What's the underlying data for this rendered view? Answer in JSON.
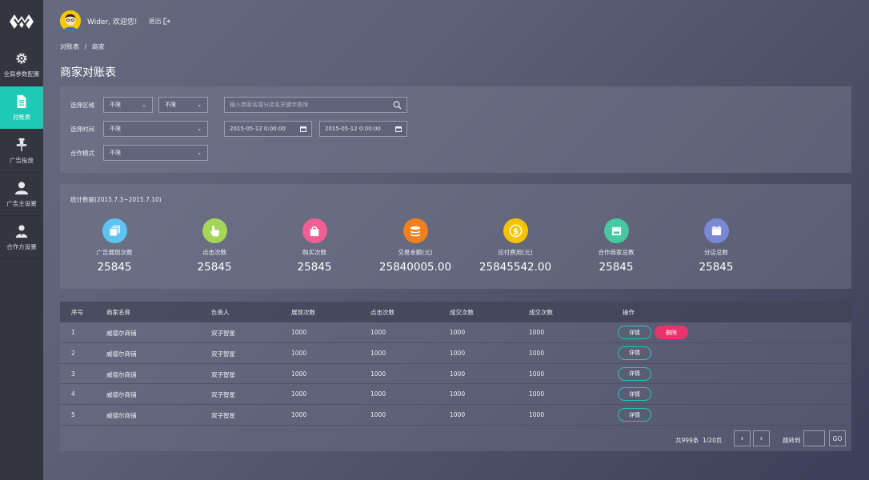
{
  "sidebar": {
    "items": [
      {
        "label": "全局参数配置",
        "icon": "gear-icon"
      },
      {
        "label": "对账表",
        "icon": "document-icon"
      },
      {
        "label": "广告投放",
        "icon": "pin-icon"
      },
      {
        "label": "广告主设置",
        "icon": "user-icon"
      },
      {
        "label": "合作方设置",
        "icon": "user-group-icon"
      }
    ],
    "active_color": "#1ec9b6"
  },
  "header": {
    "welcome": "Wider, 欢迎您!",
    "logout": "退出"
  },
  "breadcrumb": {
    "parent": "对账表",
    "separator": "/",
    "current": "商家"
  },
  "page_title": "商家对账表",
  "filters": {
    "region_label": "选择区域",
    "region_1": "不限",
    "region_2": "不限",
    "search_placeholder": "输入商家名或分店名关键字查询",
    "time_label": "选择时间",
    "time_select": "不限",
    "date_start": "2015-05-12 0:00:00",
    "date_end": "2015-05-12 0:00:00",
    "mode_label": "合作模式",
    "mode_select": "不限"
  },
  "stats": {
    "title": "统计数据(2015.7.3~2015.7.10)",
    "items": [
      {
        "label": "广告展现次数",
        "value": "25845",
        "color": "#5fc3f0",
        "icon": "layers-icon"
      },
      {
        "label": "点击次数",
        "value": "25845",
        "color": "#a5d65a",
        "icon": "pointer-icon"
      },
      {
        "label": "购买次数",
        "value": "25845",
        "color": "#ef5f92",
        "icon": "shopping-bag-icon"
      },
      {
        "label": "交易金额(元)",
        "value": "25840005.00",
        "color": "#f47f1f",
        "icon": "coins-icon"
      },
      {
        "label": "应付费用(元)",
        "value": "25845542.00",
        "color": "#f6c300",
        "icon": "dollar-icon"
      },
      {
        "label": "合作商家总数",
        "value": "25845",
        "color": "#44c9a0",
        "icon": "store-icon"
      },
      {
        "label": "分店总数",
        "value": "25845",
        "color": "#7b88d6",
        "icon": "calendar-icon"
      }
    ]
  },
  "table": {
    "headers": [
      "序号",
      "商家名称",
      "负责人",
      "展现次数",
      "点击次数",
      "成交次数",
      "成交次数",
      "操作"
    ],
    "rows": [
      [
        "1",
        "威德尔商铺",
        "双子智星",
        "1000",
        "1000",
        "1000",
        "1000"
      ],
      [
        "2",
        "威德尔商铺",
        "双子智星",
        "1000",
        "1000",
        "1000",
        "1000"
      ],
      [
        "3",
        "威德尔商铺",
        "双子智星",
        "1000",
        "1000",
        "1000",
        "1000"
      ],
      [
        "4",
        "威德尔商铺",
        "双子智星",
        "1000",
        "1000",
        "1000",
        "1000"
      ],
      [
        "5",
        "威德尔商铺",
        "双子智星",
        "1000",
        "1000",
        "1000",
        "1000"
      ]
    ],
    "detail_label": "详情",
    "delete_label": "删除"
  },
  "pagination": {
    "total": "共999条",
    "page": "1/20页",
    "prev": "‹",
    "next": "›",
    "jump_label": "跳转到",
    "go": "GO"
  }
}
